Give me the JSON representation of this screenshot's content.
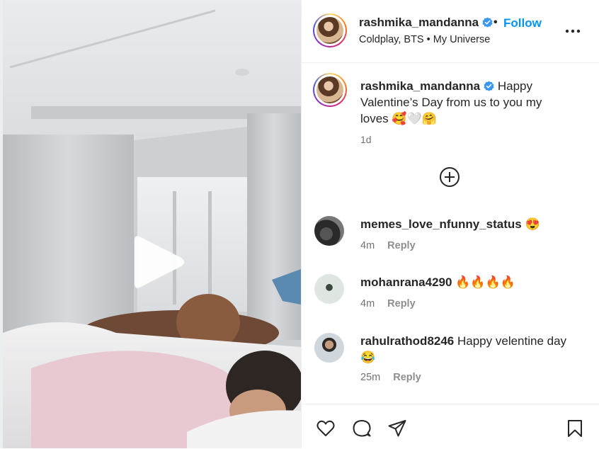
{
  "post": {
    "username": "rashmika_mandanna",
    "follow_label": "Follow",
    "separator": "•",
    "subtitle": "Coldplay, BTS • My Universe",
    "caption_text": "Happy Valentine’s Day from us to you my loves 🥰🤍🤗",
    "caption_time": "1d"
  },
  "comments": [
    {
      "username": "memes_love_nfunny_status",
      "text": "😍",
      "time": "4m",
      "reply": "Reply"
    },
    {
      "username": "mohanrana4290",
      "text": "🔥🔥🔥🔥",
      "time": "4m",
      "reply": "Reply"
    },
    {
      "username": "rahulrathod8246",
      "text": "Happy velentine day 😂",
      "time": "25m",
      "reply": "Reply"
    }
  ],
  "icons": {
    "verified": "verified-badge-icon",
    "more": "more-options-icon",
    "add": "add-circle-icon",
    "like": "heart-icon",
    "comment": "comment-icon",
    "share": "send-icon",
    "save": "bookmark-icon",
    "play": "play-icon"
  },
  "colors": {
    "link": "#0095f6",
    "verified": "#3897f0"
  }
}
